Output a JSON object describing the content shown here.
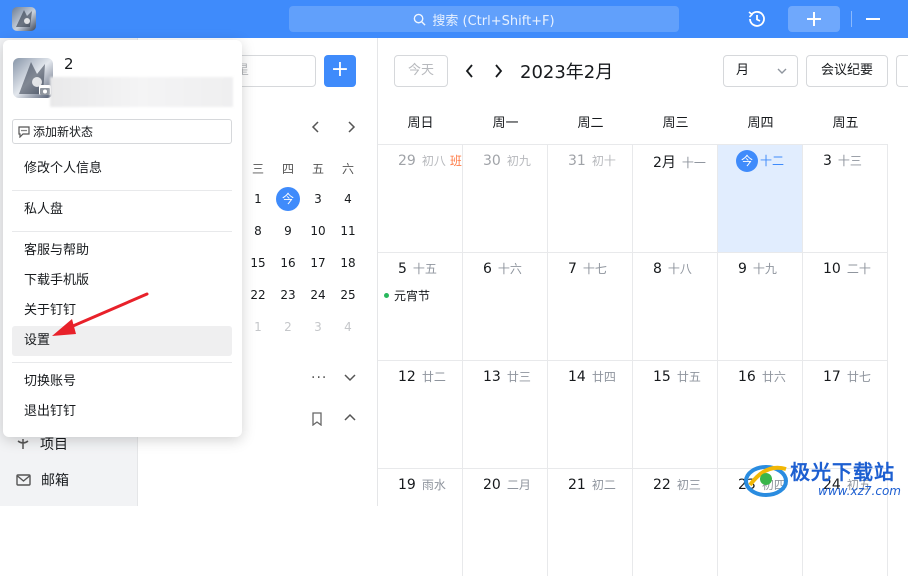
{
  "topbar": {
    "search_placeholder": "搜索 (Ctrl+Shift+F)",
    "accent": "#3f8bfb"
  },
  "sidebar": {
    "items": [
      {
        "label": "项目",
        "icon": "project-icon"
      },
      {
        "label": "邮箱",
        "icon": "mail-icon"
      }
    ]
  },
  "mini_calendar": {
    "search_placeholder": "星",
    "weekdays": [
      "三",
      "四",
      "五",
      "六"
    ],
    "rows": [
      [
        "1",
        "今",
        "3",
        "4"
      ],
      [
        "8",
        "9",
        "10",
        "11"
      ],
      [
        "15",
        "16",
        "17",
        "18"
      ],
      [
        "22",
        "23",
        "24",
        "25"
      ],
      [
        "1",
        "2",
        "3",
        "4"
      ]
    ],
    "more": "···"
  },
  "calendar": {
    "today_label": "今天",
    "month_title": "2023年2月",
    "view": "月",
    "minutes_label": "会议纪要",
    "weekdays": [
      "周日",
      "周一",
      "周二",
      "周三",
      "周四",
      "周五"
    ],
    "weeks": [
      [
        {
          "day": "29",
          "lunar": "初八",
          "badge": "班",
          "dim": true
        },
        {
          "day": "30",
          "lunar": "初九",
          "dim": true
        },
        {
          "day": "31",
          "lunar": "初十",
          "dim": true
        },
        {
          "day": "2月",
          "lunar": "十一"
        },
        {
          "day": "今",
          "lunar": "十二",
          "today": true
        },
        {
          "day": "3",
          "lunar": "十三"
        }
      ],
      [
        {
          "day": "5",
          "lunar": "十五",
          "event": "元宵节"
        },
        {
          "day": "6",
          "lunar": "十六"
        },
        {
          "day": "7",
          "lunar": "十七"
        },
        {
          "day": "8",
          "lunar": "十八"
        },
        {
          "day": "9",
          "lunar": "十九"
        },
        {
          "day": "10",
          "lunar": "二十"
        }
      ],
      [
        {
          "day": "12",
          "lunar": "廿二"
        },
        {
          "day": "13",
          "lunar": "廿三"
        },
        {
          "day": "14",
          "lunar": "廿四"
        },
        {
          "day": "15",
          "lunar": "廿五"
        },
        {
          "day": "16",
          "lunar": "廿六"
        },
        {
          "day": "17",
          "lunar": "廿七"
        }
      ],
      [
        {
          "day": "19",
          "lunar": "雨水"
        },
        {
          "day": "20",
          "lunar": "二月"
        },
        {
          "day": "21",
          "lunar": "初二"
        },
        {
          "day": "22",
          "lunar": "初三"
        },
        {
          "day": "23",
          "lunar": "初四"
        },
        {
          "day": "24",
          "lunar": "初五"
        }
      ]
    ]
  },
  "popup": {
    "name": "2",
    "status_button": "添加新状态",
    "items": {
      "edit_profile": "修改个人信息",
      "private_disk": "私人盘",
      "support": "客服与帮助",
      "download_mobile": "下载手机版",
      "about": "关于钉钉",
      "settings": "设置",
      "switch_account": "切换账号",
      "logout": "退出钉钉"
    }
  },
  "watermark": {
    "title": "极光下载站",
    "url": "www.xz7.com"
  }
}
